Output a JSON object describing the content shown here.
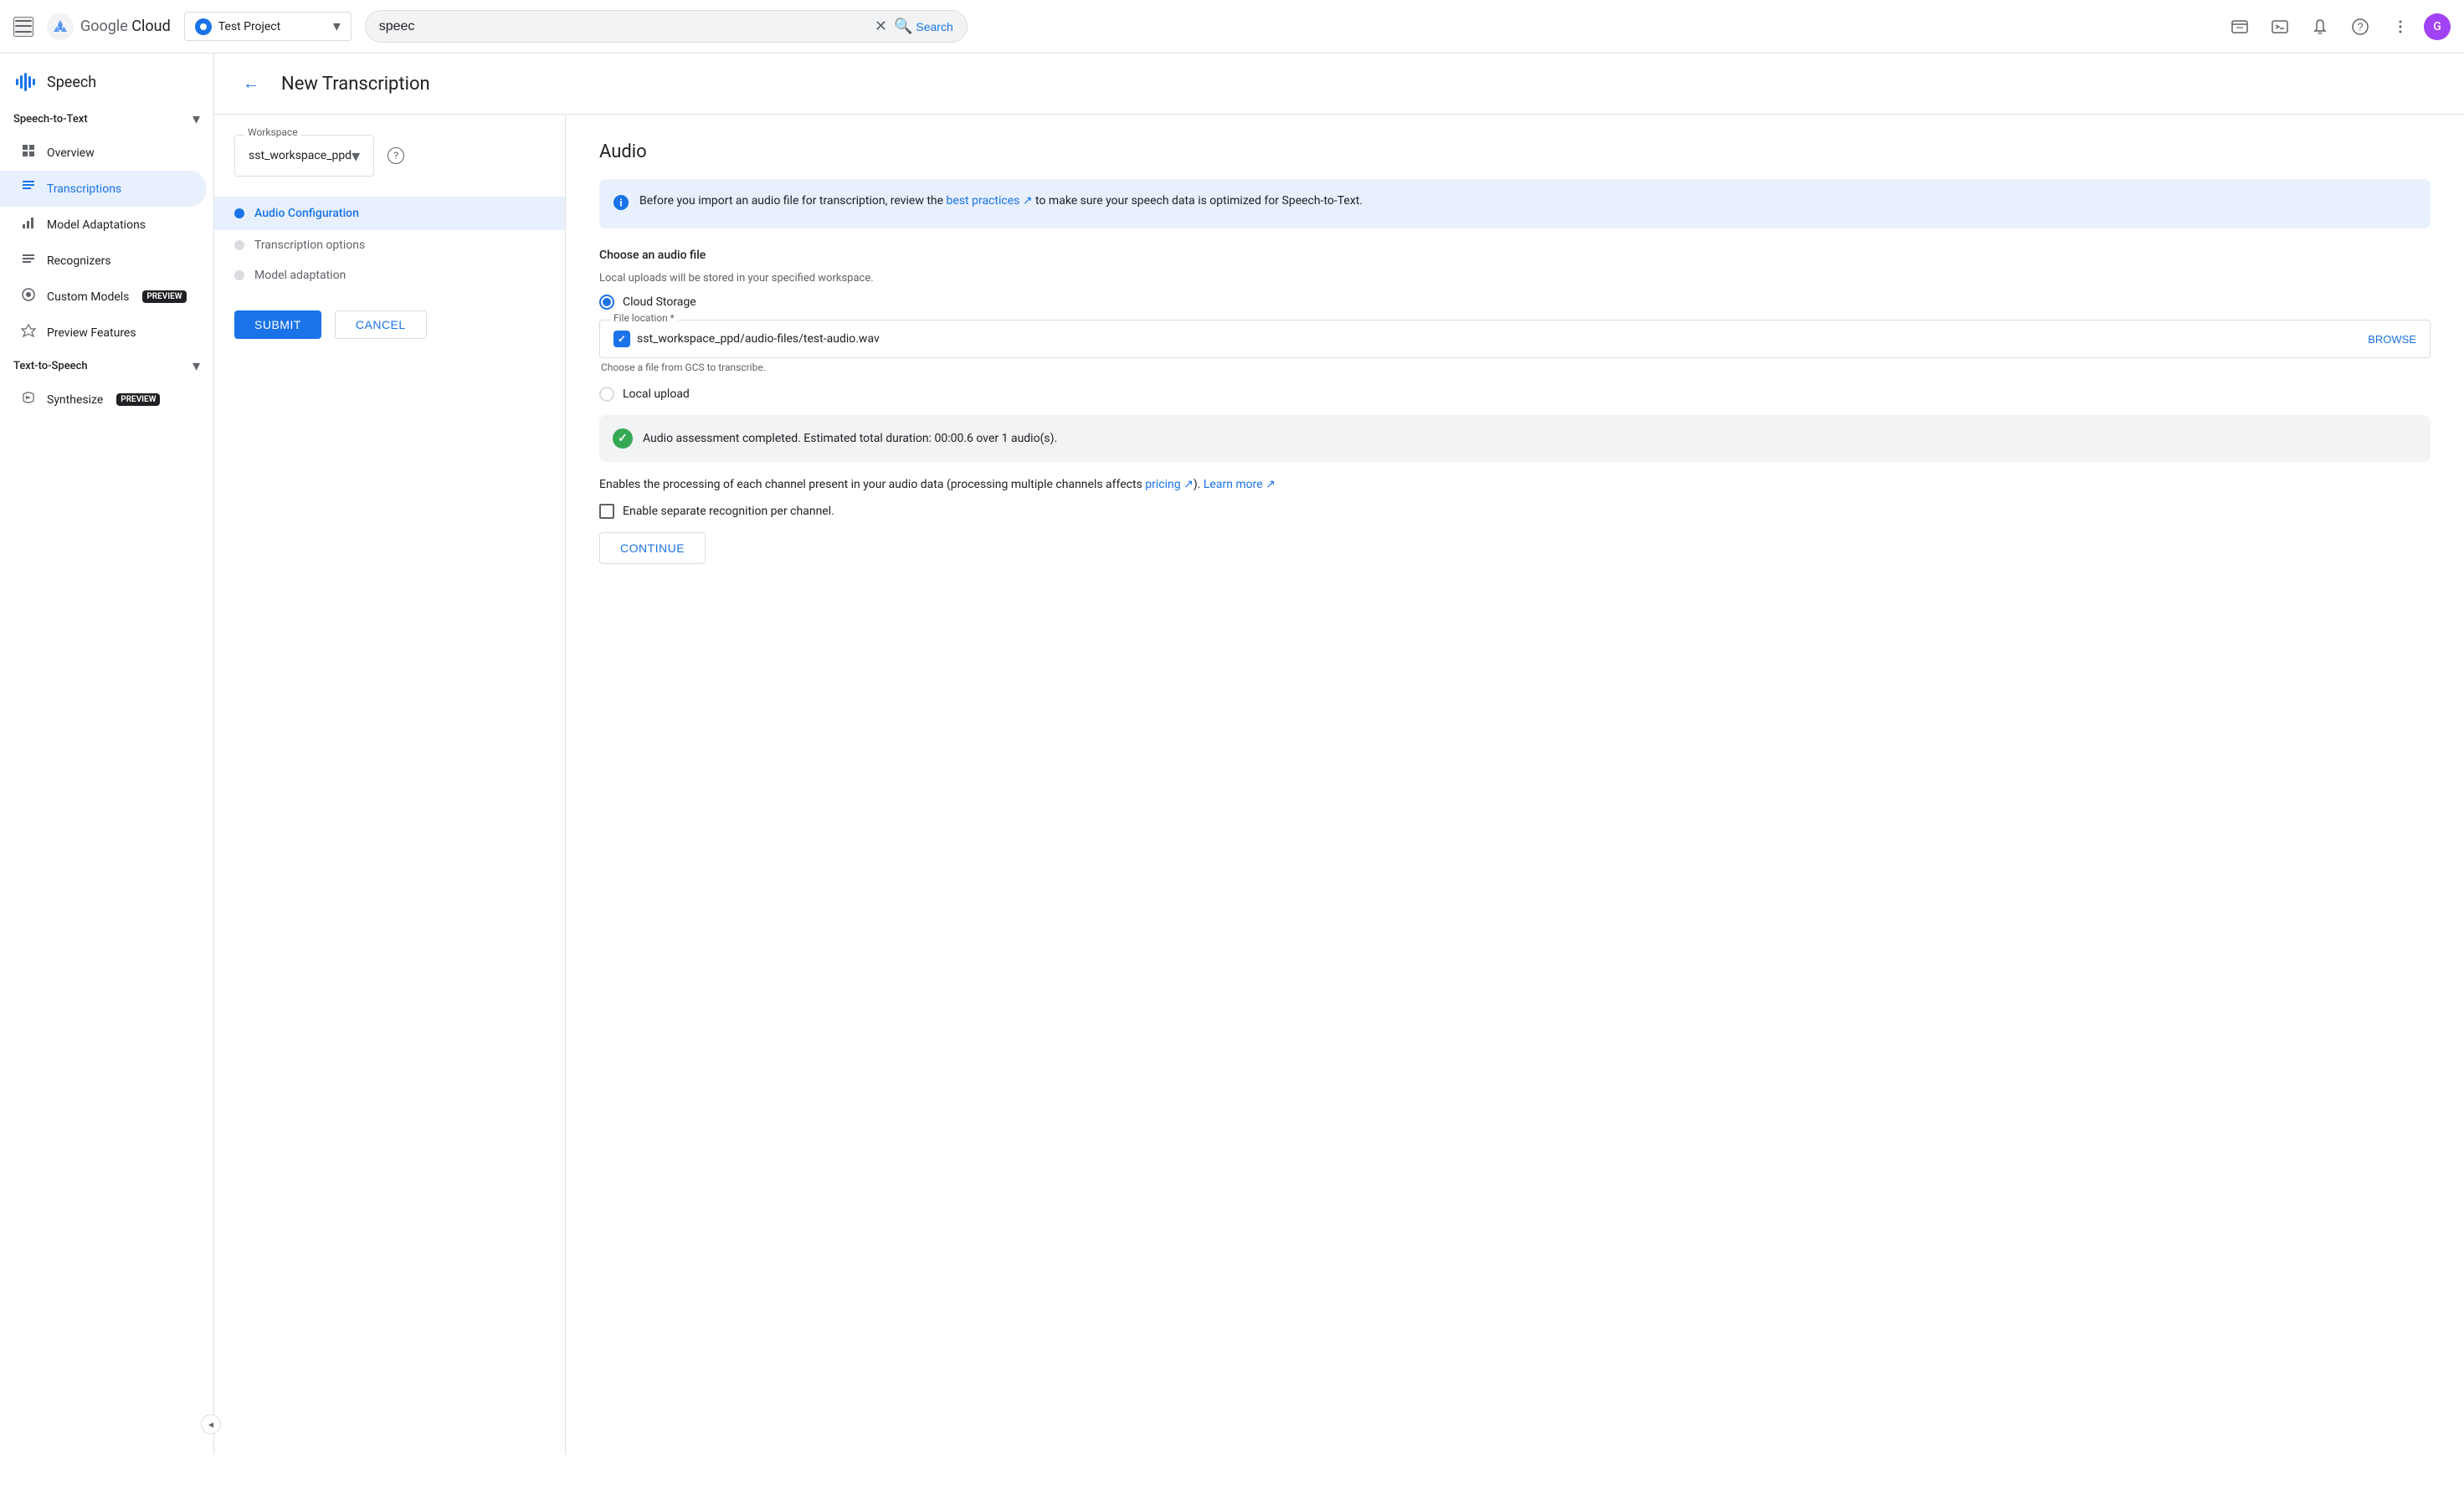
{
  "topNav": {
    "hamburger_label": "Menu",
    "logo_text": "Google Cloud",
    "project": {
      "name": "Test Project",
      "chevron": "▾"
    },
    "search": {
      "value": "speec",
      "placeholder": "Search",
      "clear_label": "✕",
      "search_label": "Search"
    },
    "icons": {
      "support": "💬",
      "terminal": "⬛",
      "bell": "🔔",
      "help": "?",
      "more": "⋮"
    },
    "avatar_initial": "G"
  },
  "sidebar": {
    "app_name": "Speech",
    "sections": [
      {
        "id": "speech-to-text",
        "title": "Speech-to-Text",
        "expanded": true,
        "items": [
          {
            "id": "overview",
            "label": "Overview",
            "icon": "⌂",
            "active": false,
            "preview": false
          },
          {
            "id": "transcriptions",
            "label": "Transcriptions",
            "icon": "☰",
            "active": true,
            "preview": false
          },
          {
            "id": "model-adaptations",
            "label": "Model Adaptations",
            "icon": "📊",
            "active": false,
            "preview": false
          },
          {
            "id": "recognizers",
            "label": "Recognizers",
            "icon": "☰",
            "active": false,
            "preview": false
          },
          {
            "id": "custom-models",
            "label": "Custom Models",
            "icon": "◉",
            "active": false,
            "preview": true,
            "badge_text": "PREVIEW"
          },
          {
            "id": "preview-features",
            "label": "Preview Features",
            "icon": "◈",
            "active": false,
            "preview": false
          }
        ]
      },
      {
        "id": "text-to-speech",
        "title": "Text-to-Speech",
        "expanded": true,
        "items": [
          {
            "id": "synthesize",
            "label": "Synthesize",
            "icon": "🎵",
            "active": false,
            "preview": true,
            "badge_text": "PREVIEW"
          }
        ]
      }
    ],
    "collapse_label": "◂"
  },
  "pageHeader": {
    "back_label": "←",
    "title": "New Transcription"
  },
  "leftPanel": {
    "workspace_label": "Workspace",
    "workspace_value": "sst_workspace_ppd",
    "workspace_chevron": "▾",
    "workspace_help": "?",
    "steps": [
      {
        "id": "audio-config",
        "label": "Audio Configuration",
        "active": true
      },
      {
        "id": "transcription-options",
        "label": "Transcription options",
        "active": false
      },
      {
        "id": "model-adaptation",
        "label": "Model adaptation",
        "active": false
      }
    ],
    "submit_label": "SUBMIT",
    "cancel_label": "CANCEL"
  },
  "rightPanel": {
    "title": "Audio",
    "infoBox": {
      "text_before_link": "Before you import an audio file for transcription, review the ",
      "link_text": "best practices",
      "text_after_link": " to make sure your speech data is optimized for Speech-to-Text."
    },
    "chooseLabel": "Choose an audio file",
    "localUploadsNote": "Local uploads will be stored in your specified workspace.",
    "options": [
      {
        "id": "cloud-storage",
        "label": "Cloud Storage",
        "selected": true
      },
      {
        "id": "local-upload",
        "label": "Local upload",
        "selected": false
      }
    ],
    "fileLocation": {
      "label": "File location *",
      "value": "sst_workspace_ppd/audio-files/test-audio.wav",
      "browse_label": "BROWSE",
      "hint": "Choose a file from GCS to transcribe."
    },
    "assessment": {
      "text": "Audio assessment completed. Estimated total duration: 00:00.6 over 1 audio(s)."
    },
    "channelSection": {
      "description_before_pricing": "Enables the processing of each channel present in your audio data (processing multiple channels affects ",
      "pricing_link": "pricing",
      "description_after_pricing": "). ",
      "learn_more_link": "Learn more",
      "checkbox_label": "Enable separate recognition per channel.",
      "checked": false
    },
    "continue_label": "CONTINUE"
  }
}
